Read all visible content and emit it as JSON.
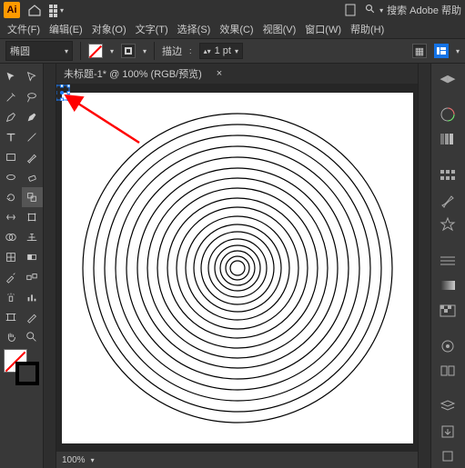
{
  "app": {
    "logo_text": "Ai",
    "search_placeholder": "搜索 Adobe 帮助"
  },
  "menu": {
    "file": "文件(F)",
    "edit": "编辑(E)",
    "object": "对象(O)",
    "type": "文字(T)",
    "select": "选择(S)",
    "effect": "效果(C)",
    "view": "视图(V)",
    "window": "窗口(W)",
    "help": "帮助(H)"
  },
  "options": {
    "shape_label": "椭圆",
    "stroke_label": "描边",
    "stroke_weight": "1 pt"
  },
  "document": {
    "tab_title": "未标题-1* @ 100% (RGB/预览)",
    "zoom": "100%"
  },
  "colors": {
    "accent": "#ff9a00",
    "annotation": "#ff0000",
    "selection": "#1e7fff"
  }
}
